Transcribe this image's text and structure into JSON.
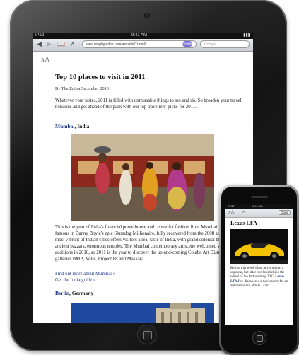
{
  "ipad": {
    "status": {
      "carrier": "iPad",
      "time": "9:41 AM"
    },
    "toolbar": {
      "url": "www.roughguides.com/website/Travel/...",
      "reader_label": "Reader",
      "search_placeholder": "Google",
      "back_icon": "back-arrow-icon",
      "forward_icon": "forward-arrow-icon",
      "bookmarks_icon": "bookmarks-icon",
      "share_icon": "share-icon"
    },
    "article": {
      "font_control": "ᴀA",
      "title": "Top 10 places to visit in 2011",
      "byline": "By The EditorDecember 2010",
      "intro": "Whatever your tastes, 2011 is filled with unmissable things to see and do. So broaden your travel horizons and get ahead of the pack with our top travellers' picks for 2011.",
      "section1": {
        "city": "Mumbai",
        "country": ", India"
      },
      "body": "This is the year of India's financial powerhouse and centre for fashion film, Mumbai. Made famous in Danny Boyle's epic Slumdog Millionaire, fully recovered from the 2008 attacks, this most vibrant of Indian cities offers visitors a real taste of India, with grand colonial buildings, ancient bazaars, enormous temples. The Mumbai contemporary art scene welcomed some exciting additions in 2010, so 2011 is the year to discover the up-and-coming Colaba Art District's galleries BMB, Volte, Project 88 and Maskara.",
      "link1": "Find out more about Mumbai »",
      "link2": "Get the India guide »",
      "section2": {
        "city": "Berlin",
        "country": ", Germany"
      }
    }
  },
  "iphone": {
    "status": {
      "carrier": "AT&T",
      "time": "9:41 AM"
    },
    "toolbar": {
      "font_control": "ᴀA",
      "share_icon": "share-icon",
      "done_label": "Done"
    },
    "article": {
      "title": "Lexus LFA",
      "text_before": "Before this week I had never driven a supercar, but after two laps behind the wheel of the forthcoming 2012 ",
      "text_link": "Lexus LFA",
      "text_after": " I've discovered a new source for an adrenaline fix. While I can't"
    }
  },
  "colors": {
    "link": "#1f3a8a",
    "reader_badge": "#7a6fd3",
    "car": "#f2c200"
  }
}
